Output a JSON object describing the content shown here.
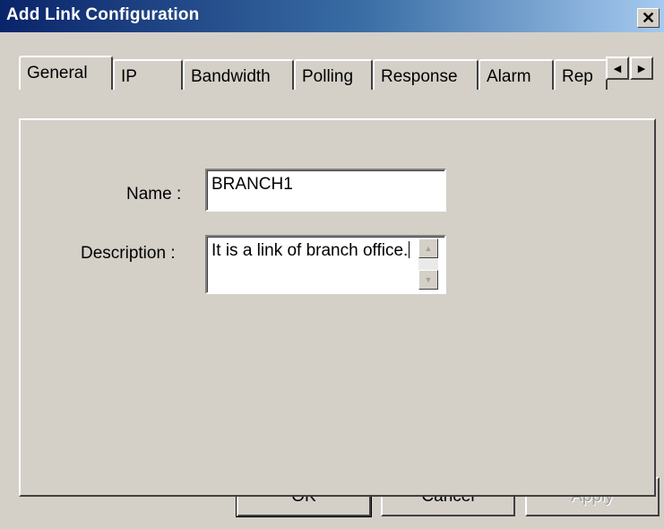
{
  "window": {
    "title": "Add Link Configuration",
    "close_glyph": "✕"
  },
  "tabs": [
    {
      "label": "General",
      "active": true
    },
    {
      "label": "IP",
      "active": false
    },
    {
      "label": "Bandwidth",
      "active": false
    },
    {
      "label": "Polling",
      "active": false
    },
    {
      "label": "Response",
      "active": false
    },
    {
      "label": "Alarm",
      "active": false
    },
    {
      "label": "Rep",
      "active": false
    }
  ],
  "tab_scroll": {
    "left_icon": "triangle-left-icon",
    "right_icon": "triangle-right-icon"
  },
  "form": {
    "name_label": "Name :",
    "name_value": "BRANCH1",
    "description_label": "Description :",
    "description_value": "It is a link of branch office."
  },
  "buttons": {
    "ok": "OK",
    "cancel": "Cancel",
    "apply": "Apply"
  },
  "colors": {
    "titlebar_start": "#0a246a",
    "titlebar_end": "#a6caf0",
    "face": "#d4d0c8"
  }
}
